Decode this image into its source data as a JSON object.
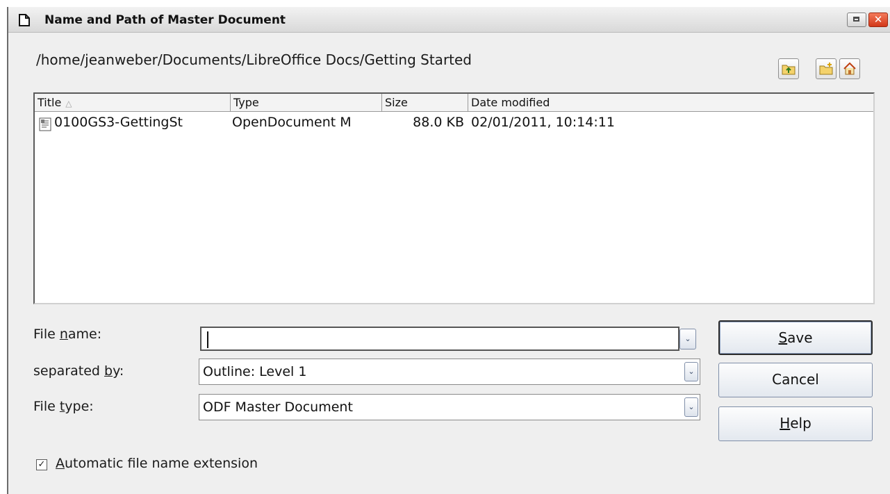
{
  "window": {
    "title": "Name and Path of Master Document",
    "close_glyph": "✕"
  },
  "path": "/home/jeanweber/Documents/LibreOffice Docs/Getting Started",
  "toolbar": {
    "icons": [
      "folder-up-icon",
      "new-folder-icon",
      "home-icon"
    ]
  },
  "file_list": {
    "columns": [
      "Title",
      "Type",
      "Size",
      "Date modified"
    ],
    "sort_indicator": "△",
    "rows": [
      {
        "title": "0100GS3-GettingSt",
        "type": "OpenDocument M",
        "size": "88.0 KB",
        "date": "02/01/2011, 10:14:11"
      }
    ]
  },
  "form": {
    "file_name": {
      "label_pre": "File ",
      "label_u": "n",
      "label_post": "ame:",
      "value": ""
    },
    "separated_by": {
      "label_pre": "separated ",
      "label_u": "b",
      "label_post": "y:",
      "value": "Outline: Level 1"
    },
    "file_type": {
      "label_pre": "File ",
      "label_u": "t",
      "label_post": "ype:",
      "value": "ODF Master Document"
    }
  },
  "buttons": {
    "save": {
      "u": "S",
      "rest": "ave"
    },
    "cancel": "Cancel",
    "help": {
      "u": "H",
      "rest": "elp"
    }
  },
  "auto_extension": {
    "checked": true,
    "check_glyph": "✓",
    "label_u": "A",
    "label_rest": "utomatic file name extension"
  },
  "dropdown_glyph": "⌄"
}
